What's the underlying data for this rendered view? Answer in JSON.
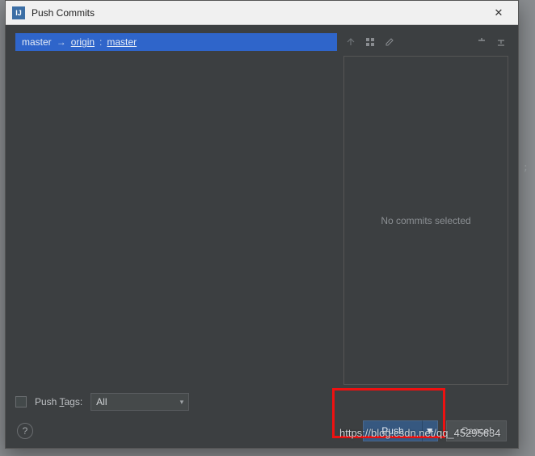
{
  "titlebar": {
    "title": "Push Commits",
    "close_glyph": "✕"
  },
  "branch": {
    "local": "master",
    "arrow": "→",
    "remote": "origin",
    "separator": ":",
    "remote_branch": "master"
  },
  "right_panel": {
    "empty_text": "No commits selected"
  },
  "tags": {
    "checkbox_label_pre": "Push ",
    "checkbox_label_mnemonic": "T",
    "checkbox_label_post": "ags:",
    "selected_option": "All"
  },
  "buttons": {
    "push": "Push",
    "cancel": "Cancel",
    "caret": "▼"
  },
  "help": {
    "glyph": "?"
  },
  "watermark": "https://blog.csdn.net/qq_45295634",
  "backdrop_code": ") ;"
}
